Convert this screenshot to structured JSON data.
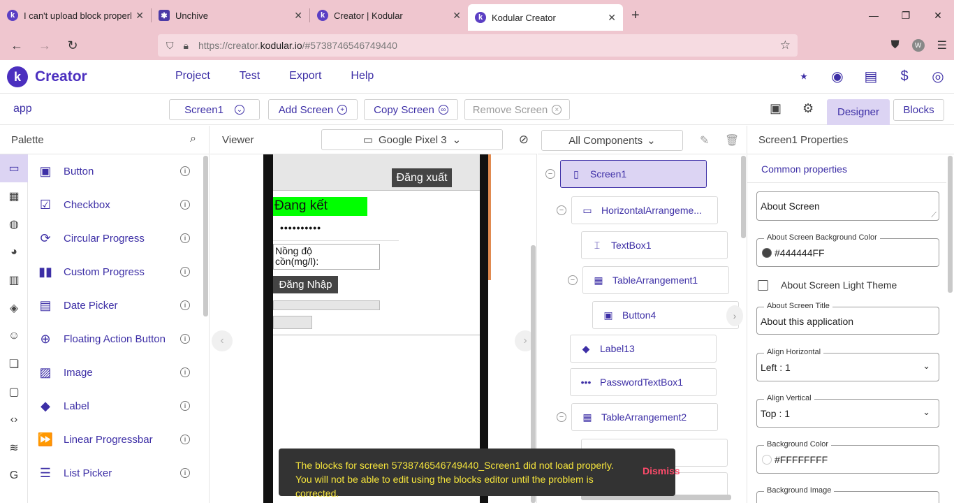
{
  "browser": {
    "tabs": [
      {
        "title": "I can't upload block properly fr",
        "icon": "kodular-icon"
      },
      {
        "title": "Unchive",
        "icon": "puzzle-icon"
      },
      {
        "title": "Creator | Kodular",
        "icon": "kodular-icon"
      },
      {
        "title": "Kodular Creator",
        "icon": "kodular-icon",
        "active": true
      }
    ],
    "url_prefix": "https://creator.",
    "url_domain": "kodular.io",
    "url_suffix": "/#5738746546749440",
    "profile_initial": "W"
  },
  "app": {
    "logo_letter": "k",
    "brand": "Creator",
    "menu": [
      "Project",
      "Test",
      "Export",
      "Help"
    ]
  },
  "toolbar": {
    "project_name": "app",
    "screen_select": "Screen1",
    "add_screen": "Add Screen",
    "copy_screen": "Copy Screen",
    "remove_screen": "Remove Screen",
    "designer": "Designer",
    "blocks": "Blocks"
  },
  "palette": {
    "title": "Palette",
    "items": [
      {
        "label": "Button",
        "icon": "button-icon"
      },
      {
        "label": "Checkbox",
        "icon": "checkbox-icon"
      },
      {
        "label": "Circular Progress",
        "icon": "circular-progress-icon"
      },
      {
        "label": "Custom Progress",
        "icon": "custom-progress-icon"
      },
      {
        "label": "Date Picker",
        "icon": "date-picker-icon"
      },
      {
        "label": "Floating Action Button",
        "icon": "fab-icon"
      },
      {
        "label": "Image",
        "icon": "image-icon"
      },
      {
        "label": "Label",
        "icon": "label-icon"
      },
      {
        "label": "Linear Progressbar",
        "icon": "linear-progressbar-icon"
      },
      {
        "label": "List Picker",
        "icon": "list-picker-icon"
      }
    ]
  },
  "viewer": {
    "title": "Viewer",
    "device": "Google Pixel 3",
    "phone": {
      "logout_button": "Đăng xuất",
      "green_label": "Đang kết",
      "password_dots": "••••••••••",
      "concentration_label_1": "Nồng độ",
      "concentration_label_2": "cồn(mg/l):",
      "login_button": "Đăng Nhập"
    }
  },
  "components": {
    "filter": "All Components",
    "tree": [
      {
        "label": "Screen1",
        "icon": "phone-icon",
        "selected": true
      },
      {
        "label": "HorizontalArrangeme...",
        "icon": "horizontal-arrangement-icon"
      },
      {
        "label": "TextBox1",
        "icon": "textbox-icon"
      },
      {
        "label": "TableArrangement1",
        "icon": "table-icon"
      },
      {
        "label": "Button4",
        "icon": "button-icon"
      },
      {
        "label": "Label13",
        "icon": "label-icon"
      },
      {
        "label": "PasswordTextBox1",
        "icon": "password-textbox-icon"
      },
      {
        "label": "TableArrangement2",
        "icon": "table-icon"
      }
    ]
  },
  "properties": {
    "title": "Screen1 Properties",
    "section": "Common properties",
    "about_screen": "About Screen",
    "bg_color_label": "About Screen Background Color",
    "bg_color_value": "#444444FF",
    "bg_color_swatch": "#444444",
    "light_theme_label": "About Screen Light Theme",
    "title_label": "About Screen Title",
    "title_value": "About this application",
    "align_h_label": "Align Horizontal",
    "align_h_value": "Left : 1",
    "align_v_label": "Align Vertical",
    "align_v_value": "Top : 1",
    "background_color_label": "Background Color",
    "background_color_value": "#FFFFFFFF",
    "background_image_label": "Background Image"
  },
  "snackbar": {
    "message": "The blocks for screen 5738746546749440_Screen1 did not load properly. You will not be able to edit using the blocks editor until the problem is corrected.",
    "action": "Dismiss"
  },
  "colors": {
    "accent": "#3d2fa6",
    "brand": "#4b2fbf",
    "selection": "#dcd4f3",
    "browser_chrome": "#efc6cf"
  }
}
